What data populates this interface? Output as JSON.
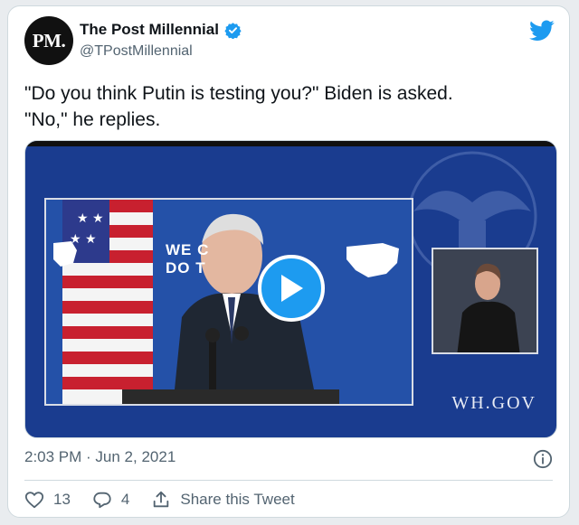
{
  "tweet": {
    "avatar_text": "PM.",
    "display_name": "The Post Millennial",
    "handle": "@TPostMillennial",
    "text_line1": "\"Do you think Putin is testing you?\" Biden is asked.",
    "text_line2": "\"No,\" he replies.",
    "timestamp": "2:03 PM · Jun 2, 2021",
    "likes": "13",
    "replies": "4",
    "share_label": "Share this Tweet"
  },
  "media": {
    "stage_text_line1": "WE C",
    "stage_text_line2": "DO T",
    "watermark": "WH.GOV"
  },
  "icons": {
    "brand": "twitter-bird-icon",
    "verified": "verified-badge-icon",
    "play": "play-icon",
    "info": "info-icon",
    "like": "heart-icon",
    "reply": "reply-bubble-icon",
    "share": "share-icon"
  },
  "colors": {
    "accent": "#1d9bf0",
    "text_primary": "#0f1419",
    "text_secondary": "#536471",
    "media_bg": "#1a3c8f"
  }
}
